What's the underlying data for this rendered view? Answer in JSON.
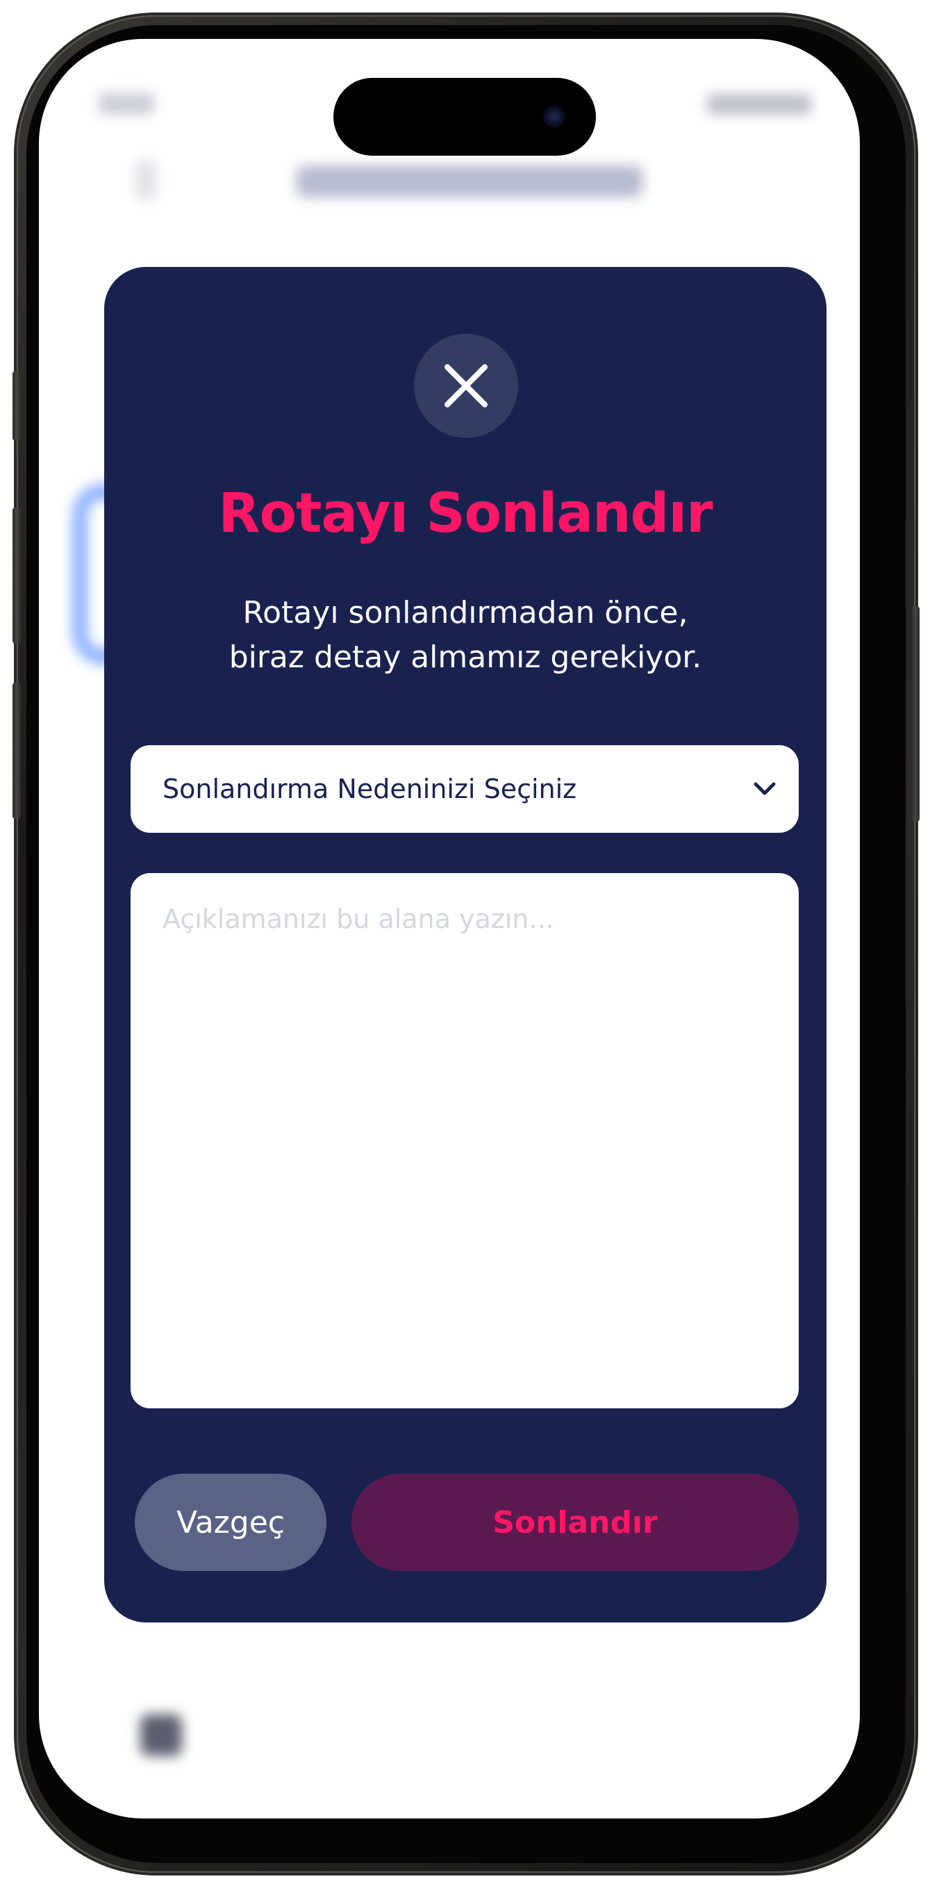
{
  "modal": {
    "title": "Rotayı Sonlandır",
    "description_line1": "Rotayı sonlandırmadan önce,",
    "description_line2": "biraz detay almamız gerekiyor.",
    "reason_select": {
      "selected_label": "Sonlandırma Nedeninizi Seçiniz"
    },
    "comment_field": {
      "value": "",
      "placeholder": "Açıklamanızı bu alana yazın..."
    },
    "cancel_label": "Vazgeç",
    "submit_label": "Sonlandır"
  },
  "icons": {
    "close": "close-icon",
    "dropdown": "chevron-down-icon",
    "home": "home-icon"
  },
  "colors": {
    "modal_bg": "#19224f",
    "accent": "#ff1766",
    "close_button_bg": "#333c63",
    "cancel_button_bg": "#5a6286",
    "submit_button_bg": "#5a1a50"
  }
}
